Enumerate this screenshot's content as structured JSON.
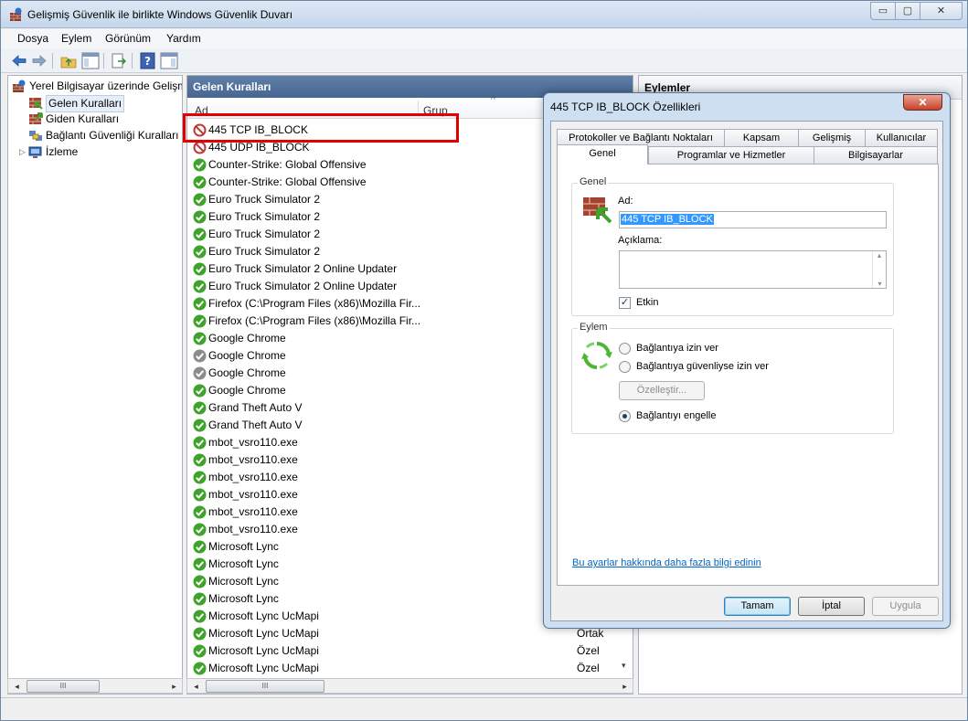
{
  "window": {
    "title": "Gelişmiş Güvenlik ile birlikte Windows Güvenlik Duvarı",
    "min_glyph": "▭",
    "max_glyph": "▢",
    "close_glyph": "✕"
  },
  "menu": [
    "Dosya",
    "Eylem",
    "Görünüm",
    "Yardım"
  ],
  "tree": {
    "root": "Yerel Bilgisayar üzerinde Gelişm",
    "items": [
      "Gelen Kuralları",
      "Giden Kuralları",
      "Bağlantı Güvenliği Kuralları",
      "İzleme"
    ],
    "expander": "▷"
  },
  "scroll": {
    "left": "◂",
    "right": "▸",
    "thumb": "III",
    "down": "▾"
  },
  "rules_pane": {
    "header": "Gelen Kuralları",
    "columns": [
      "Ad",
      "Grup"
    ],
    "sort_indicator": "^",
    "rows": [
      {
        "name": "445 TCP IB_BLOCK",
        "status": "block",
        "group": ""
      },
      {
        "name": "445 UDP IB_BLOCK",
        "status": "block",
        "group": ""
      },
      {
        "name": "Counter-Strike: Global Offensive",
        "status": "allow",
        "group": ""
      },
      {
        "name": "Counter-Strike: Global Offensive",
        "status": "allow",
        "group": ""
      },
      {
        "name": "Euro Truck Simulator 2",
        "status": "allow",
        "group": ""
      },
      {
        "name": "Euro Truck Simulator 2",
        "status": "allow",
        "group": ""
      },
      {
        "name": "Euro Truck Simulator 2",
        "status": "allow",
        "group": ""
      },
      {
        "name": "Euro Truck Simulator 2",
        "status": "allow",
        "group": ""
      },
      {
        "name": "Euro Truck Simulator 2 Online Updater",
        "status": "allow",
        "group": ""
      },
      {
        "name": "Euro Truck Simulator 2 Online Updater",
        "status": "allow",
        "group": ""
      },
      {
        "name": "Firefox (C:\\Program Files (x86)\\Mozilla Fir...",
        "status": "allow",
        "group": ""
      },
      {
        "name": "Firefox (C:\\Program Files (x86)\\Mozilla Fir...",
        "status": "allow",
        "group": ""
      },
      {
        "name": "Google Chrome",
        "status": "allow",
        "group": ""
      },
      {
        "name": "Google Chrome",
        "status": "disabled",
        "group": ""
      },
      {
        "name": "Google Chrome",
        "status": "disabled",
        "group": ""
      },
      {
        "name": "Google Chrome",
        "status": "allow",
        "group": ""
      },
      {
        "name": "Grand Theft Auto V",
        "status": "allow",
        "group": ""
      },
      {
        "name": "Grand Theft Auto V",
        "status": "allow",
        "group": ""
      },
      {
        "name": "mbot_vsro110.exe",
        "status": "allow",
        "group": ""
      },
      {
        "name": "mbot_vsro110.exe",
        "status": "allow",
        "group": ""
      },
      {
        "name": "mbot_vsro110.exe",
        "status": "allow",
        "group": ""
      },
      {
        "name": "mbot_vsro110.exe",
        "status": "allow",
        "group": ""
      },
      {
        "name": "mbot_vsro110.exe",
        "status": "allow",
        "group": ""
      },
      {
        "name": "mbot_vsro110.exe",
        "status": "allow",
        "group": ""
      },
      {
        "name": "Microsoft Lync",
        "status": "allow",
        "group": ""
      },
      {
        "name": "Microsoft Lync",
        "status": "allow",
        "group": ""
      },
      {
        "name": "Microsoft Lync",
        "status": "allow",
        "group": ""
      },
      {
        "name": "Microsoft Lync",
        "status": "allow",
        "group": ""
      },
      {
        "name": "Microsoft Lync UcMapi",
        "status": "allow",
        "group": ""
      },
      {
        "name": "Microsoft Lync UcMapi",
        "status": "allow",
        "group": "Ortak"
      },
      {
        "name": "Microsoft Lync UcMapi",
        "status": "allow",
        "group": "Özel"
      },
      {
        "name": "Microsoft Lync UcMapi",
        "status": "allow",
        "group": "Özel"
      }
    ]
  },
  "actions_pane": {
    "header": "Eylemler"
  },
  "dialog": {
    "title": "445 TCP IB_BLOCK Özellikleri",
    "close_glyph": "✕",
    "tabs_row1": [
      "Protokoller ve Bağlantı Noktaları",
      "Kapsam",
      "Gelişmiş",
      "Kullanıcılar"
    ],
    "tabs_row2": [
      "Genel",
      "Programlar ve Hizmetler",
      "Bilgisayarlar"
    ],
    "general_group": "Genel",
    "name_label": "Ad:",
    "name_value": "445 TCP IB_BLOCK",
    "description_label": "Açıklama:",
    "scroll_up": "▴",
    "scroll_down": "▾",
    "enabled_label": "Etkin",
    "enabled_checked": true,
    "check_glyph": "✓",
    "action_group": "Eylem",
    "radio_options": [
      "Bağlantıya izin ver",
      "Bağlantıya güvenliyse izin ver",
      "Bağlantıyı engelle"
    ],
    "selected_option": 2,
    "customize_button": "Özelleştir...",
    "help_link": "Bu ayarlar hakkında daha fazla bilgi edinin",
    "ok_button": "Tamam",
    "cancel_button": "İptal",
    "apply_button": "Uygula"
  },
  "colors": {
    "allow": "#3fa32b",
    "block": "#c03a3a",
    "disabled": "#8c8c8c",
    "highlight": "#e00000"
  }
}
